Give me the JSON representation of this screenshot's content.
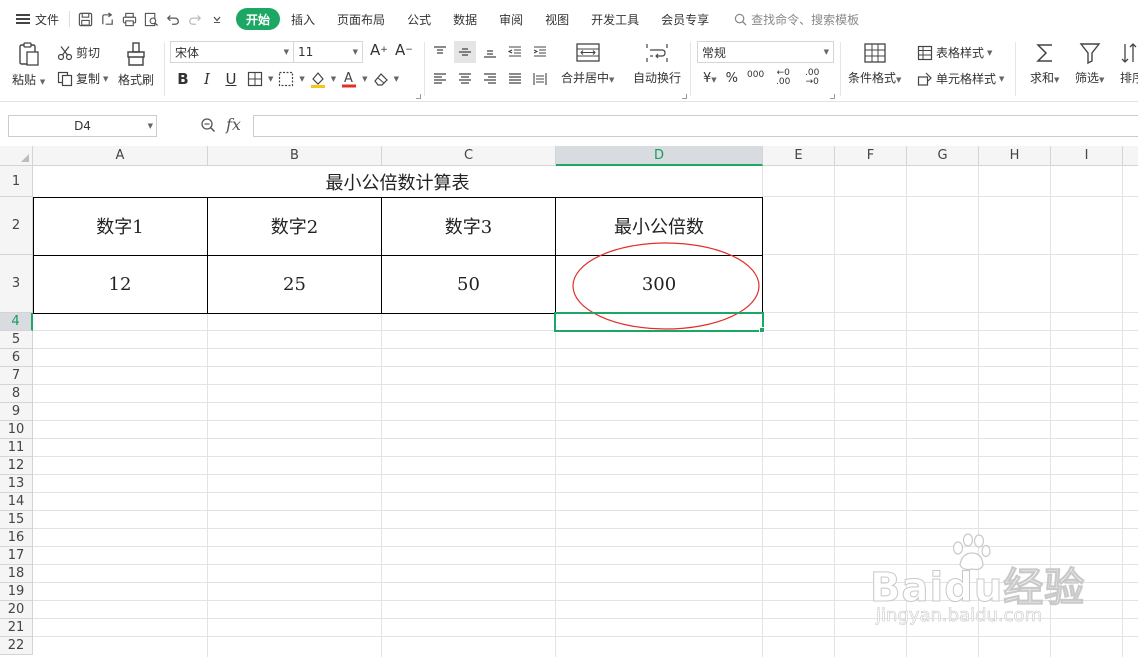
{
  "menubar": {
    "file_label": "文件",
    "tabs": [
      {
        "label": "开始",
        "active": true
      },
      {
        "label": "插入"
      },
      {
        "label": "页面布局"
      },
      {
        "label": "公式"
      },
      {
        "label": "数据"
      },
      {
        "label": "审阅"
      },
      {
        "label": "视图"
      },
      {
        "label": "开发工具"
      },
      {
        "label": "会员专享"
      }
    ],
    "search_placeholder": "查找命令、搜索模板",
    "accent_color": "#1ca765"
  },
  "ribbon": {
    "paste": "粘贴",
    "cut": "剪切",
    "copy": "复制",
    "format_painter": "格式刷",
    "font_name": "宋体",
    "font_size": "11",
    "merge_center": "合并居中",
    "wrap_text": "自动换行",
    "number_format": "常规",
    "currency_symbol": "¥",
    "percent_symbol": "%",
    "thousands_symbol": "000",
    "dec_increase": "←0 .00",
    "dec_decrease": ".00 →0",
    "conditional_format": "条件格式",
    "table_style": "表格样式",
    "cell_style": "单元格样式",
    "sum": "求和",
    "filter": "筛选",
    "sort": "排序"
  },
  "formula_bar": {
    "name_box": "D4",
    "fx_label": "fx",
    "formula": ""
  },
  "sheet": {
    "columns": [
      "A",
      "B",
      "C",
      "D",
      "E",
      "F",
      "G",
      "H",
      "I"
    ],
    "rows": [
      "1",
      "2",
      "3",
      "4",
      "5",
      "6",
      "7",
      "8",
      "9",
      "10",
      "11",
      "12",
      "13",
      "14",
      "15",
      "16",
      "17",
      "18",
      "19",
      "20",
      "21",
      "22"
    ],
    "selected_cell": "D4",
    "title": "最小公倍数计算表",
    "headers": [
      "数字1",
      "数字2",
      "数字3",
      "最小公倍数"
    ],
    "values": [
      "12",
      "25",
      "50",
      "300"
    ],
    "highlight_color": "#e0302a"
  },
  "watermark": {
    "brand": "Baidu经验",
    "url": "jingyan.baidu.com"
  }
}
